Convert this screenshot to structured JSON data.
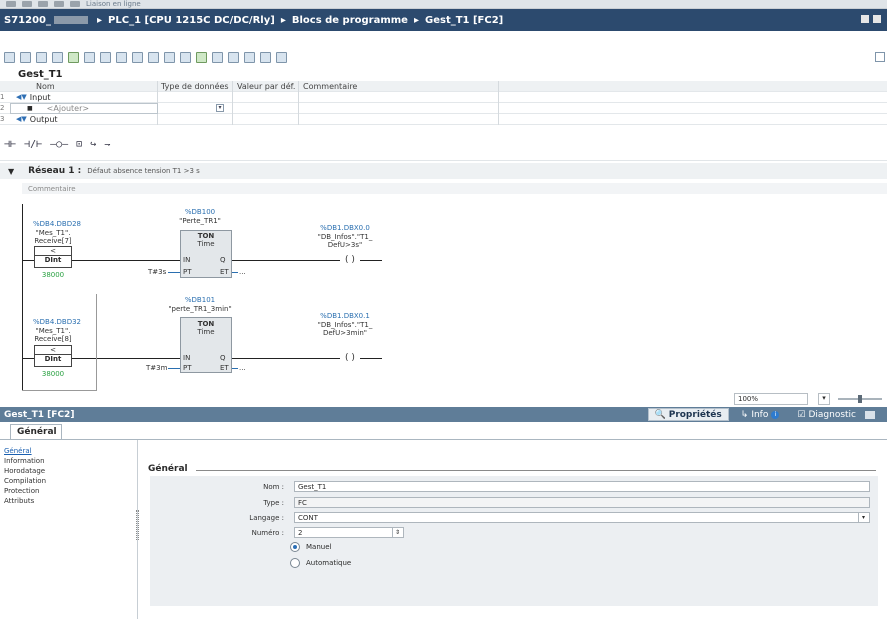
{
  "breadcrumb": {
    "project": "S71200_",
    "device": "PLC_1 [CPU 1215C DC/DC/Rly]",
    "folder": "Blocs de programme",
    "block": "Gest_T1 [FC2]"
  },
  "quick_toolbar": {
    "online_label": "Liaison en ligne"
  },
  "block_title": "Gest_T1",
  "interface": {
    "headers": {
      "name": "Nom",
      "type": "Type de données",
      "default": "Valeur par déf.",
      "comment": "Commentaire"
    },
    "rows": [
      {
        "num": "1",
        "name": "Input"
      },
      {
        "num": "2",
        "name": "<Ajouter>"
      },
      {
        "num": "3",
        "name": "Output"
      }
    ]
  },
  "lad_toolbar": [
    "⊣⊢",
    "⊣/⊢",
    "–○–",
    "⊡",
    "↪",
    "⇁"
  ],
  "network": {
    "caret": "▼",
    "title": "Réseau 1 :",
    "description": "Défaut absence tension T1 >3 s",
    "comment_placeholder": "Commentaire",
    "rung1": {
      "cmp_addr": "%DB4.DBD28",
      "cmp_tag1": "\"Mes_T1\".",
      "cmp_tag2": "Receive[7]",
      "cmp_op": "<",
      "cmp_type": "DInt",
      "cmp_value": "38000",
      "timer_db": "%DB100",
      "timer_name": "\"Perte_TR1\"",
      "timer_type": "TON",
      "timer_sub": "Time",
      "pin_in": "IN",
      "pin_q": "Q",
      "pin_pt": "PT",
      "pin_et": "ET",
      "pt_value": "T#3s",
      "et_value": "...",
      "coil_addr": "%DB1.DBX0.0",
      "coil_tag1": "\"DB_Infos\".\"T1_",
      "coil_tag2": "DefU>3s\"",
      "coil_symbol": "( )"
    },
    "rung2": {
      "cmp_addr": "%DB4.DBD32",
      "cmp_tag1": "\"Mes_T1\".",
      "cmp_tag2": "Receive[8]",
      "cmp_op": "<",
      "cmp_type": "DInt",
      "cmp_value": "38000",
      "timer_db": "%DB101",
      "timer_name": "\"perte_TR1_3min\"",
      "timer_type": "TON",
      "timer_sub": "Time",
      "pin_in": "IN",
      "pin_q": "Q",
      "pin_pt": "PT",
      "pin_et": "ET",
      "pt_value": "T#3m",
      "et_value": "...",
      "coil_addr": "%DB1.DBX0.1",
      "coil_tag1": "\"DB_Infos\".\"T1_",
      "coil_tag2": "DefU>3min\"",
      "coil_symbol": "( )"
    }
  },
  "zoom": {
    "value": "100%"
  },
  "inspector": {
    "title": "Gest_T1 [FC2]",
    "tabs": {
      "properties": "Propriétés",
      "info": "Info",
      "diagnostic": "Diagnostic"
    },
    "main_tab": "Général",
    "nav": [
      "Général",
      "Information",
      "Horodatage",
      "Compilation",
      "Protection",
      "Attributs"
    ],
    "section_title": "Général",
    "fields": {
      "name_label": "Nom :",
      "name_value": "Gest_T1",
      "type_label": "Type :",
      "type_value": "FC",
      "lang_label": "Langage :",
      "lang_value": "CONT",
      "num_label": "Numéro :",
      "num_value": "2"
    },
    "radios": {
      "manual": "Manuel",
      "auto": "Automatique"
    }
  }
}
